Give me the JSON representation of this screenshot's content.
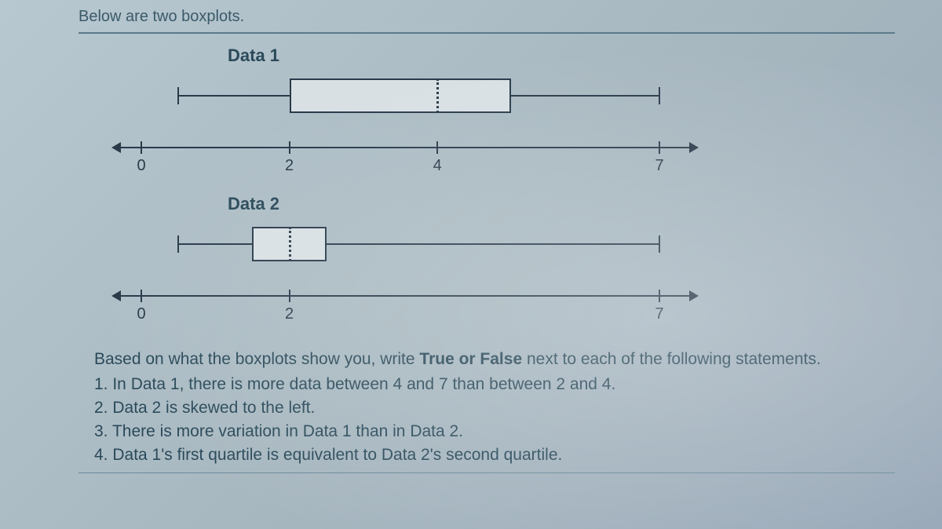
{
  "instruction": "Below are two boxplots.",
  "chart_data": [
    {
      "type": "boxplot",
      "label": "Data 1",
      "min": 0.5,
      "q1": 2,
      "median": 4,
      "q3": 5,
      "max": 7,
      "axis_ticks": [
        0,
        2,
        4,
        7
      ],
      "axis_range": [
        0,
        7
      ]
    },
    {
      "type": "boxplot",
      "label": "Data 2",
      "min": 0.5,
      "q1": 1.5,
      "median": 2,
      "q3": 2.5,
      "max": 7,
      "axis_ticks": [
        0,
        2,
        7
      ],
      "axis_range": [
        0,
        7
      ]
    }
  ],
  "question_prompt_pre": "Based on what the boxplots show you, write ",
  "question_prompt_bold": "True or False",
  "question_prompt_post": " next to each of the following statements.",
  "questions": [
    "1.  In Data 1, there is more data between 4 and 7 than between 2 and 4.",
    "2.  Data 2 is skewed to the left.",
    "3. There is more variation in Data 1 than in Data 2.",
    "4. Data 1's first quartile is equivalent to Data 2's second quartile."
  ]
}
